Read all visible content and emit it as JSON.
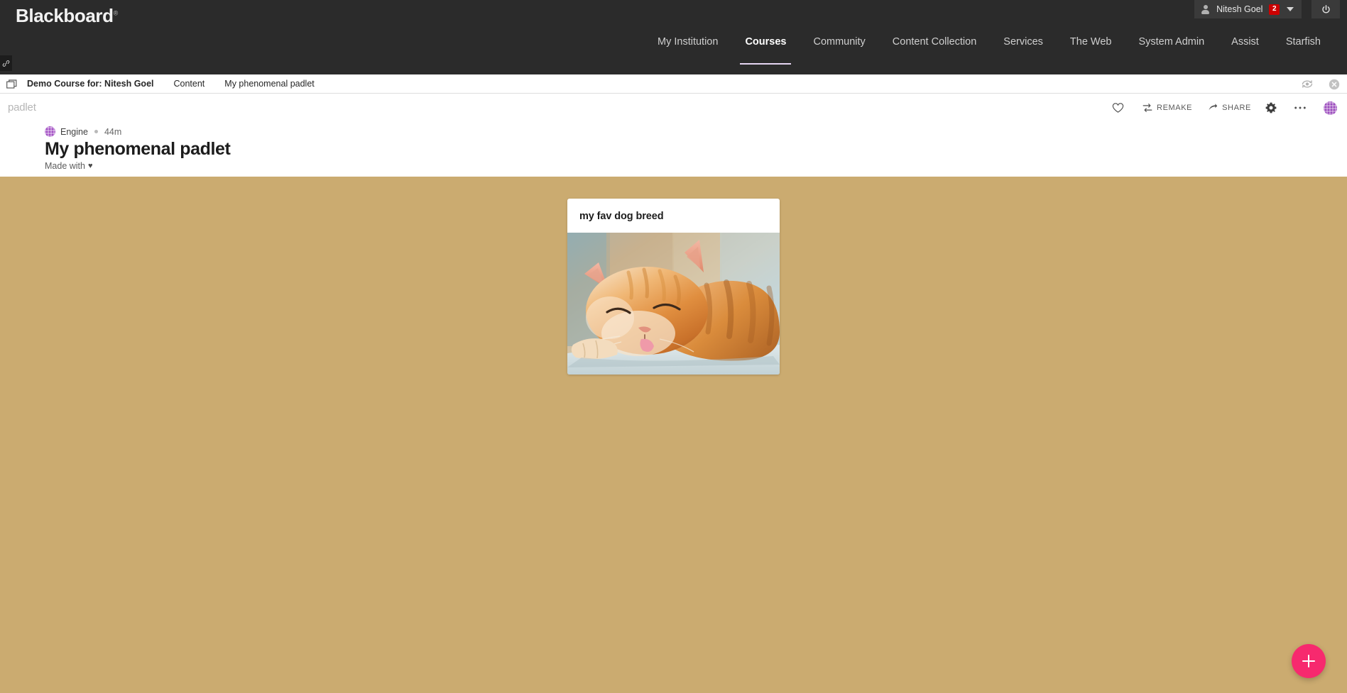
{
  "app": {
    "brand": "Blackboard",
    "brand_tm": "®"
  },
  "header": {
    "user": {
      "name": "Nitesh Goel",
      "badge_count": "2",
      "avatar_icon": "person-icon",
      "chevron_icon": "chevron-down-icon"
    },
    "power_icon": "power-icon",
    "nav": [
      {
        "label": "My Institution",
        "active": false
      },
      {
        "label": "Courses",
        "active": true
      },
      {
        "label": "Community",
        "active": false
      },
      {
        "label": "Content Collection",
        "active": false
      },
      {
        "label": "Services",
        "active": false
      },
      {
        "label": "The Web",
        "active": false
      },
      {
        "label": "System Admin",
        "active": false
      },
      {
        "label": "Assist",
        "active": false
      },
      {
        "label": "Starfish",
        "active": false
      }
    ],
    "accent_underline_color": "#e5d5f2",
    "bar_color": "#2b2b2b",
    "link_icon": "link-icon"
  },
  "breadcrumb": {
    "window_icon": "window-icon",
    "items": [
      {
        "label": "Demo Course for: Nitesh Goel",
        "bold": true
      },
      {
        "label": "Content",
        "bold": false
      },
      {
        "label": "My phenomenal padlet",
        "bold": false
      }
    ],
    "refresh_icon": "refresh-preview-icon",
    "close_icon": "close-circle-icon"
  },
  "padlet_toolbar": {
    "logo": "padlet",
    "actions": [
      {
        "name": "favorite",
        "label": "",
        "icon": "heart-icon"
      },
      {
        "name": "remake",
        "label": "REMAKE",
        "icon": "remake-icon"
      },
      {
        "name": "share",
        "label": "SHARE",
        "icon": "share-arrow-icon"
      },
      {
        "name": "settings",
        "label": "",
        "icon": "gear-icon"
      },
      {
        "name": "more",
        "label": "",
        "icon": "ellipsis-icon"
      }
    ],
    "avatar": "user-avatar",
    "avatar_color": "#9b4bbd"
  },
  "padlet_header": {
    "author": "Engine",
    "time": "44m",
    "title": "My phenomenal padlet",
    "made_with_label": "Made with",
    "heart_glyph": "♥",
    "author_avatar_color": "#a24fc4"
  },
  "canvas": {
    "background_color": "#cbab70",
    "posts": [
      {
        "title": "my fav dog breed",
        "image_alt": "sleeping orange tabby cat"
      }
    ],
    "add_button": {
      "icon": "plus-icon",
      "color": "#f7296e"
    }
  }
}
